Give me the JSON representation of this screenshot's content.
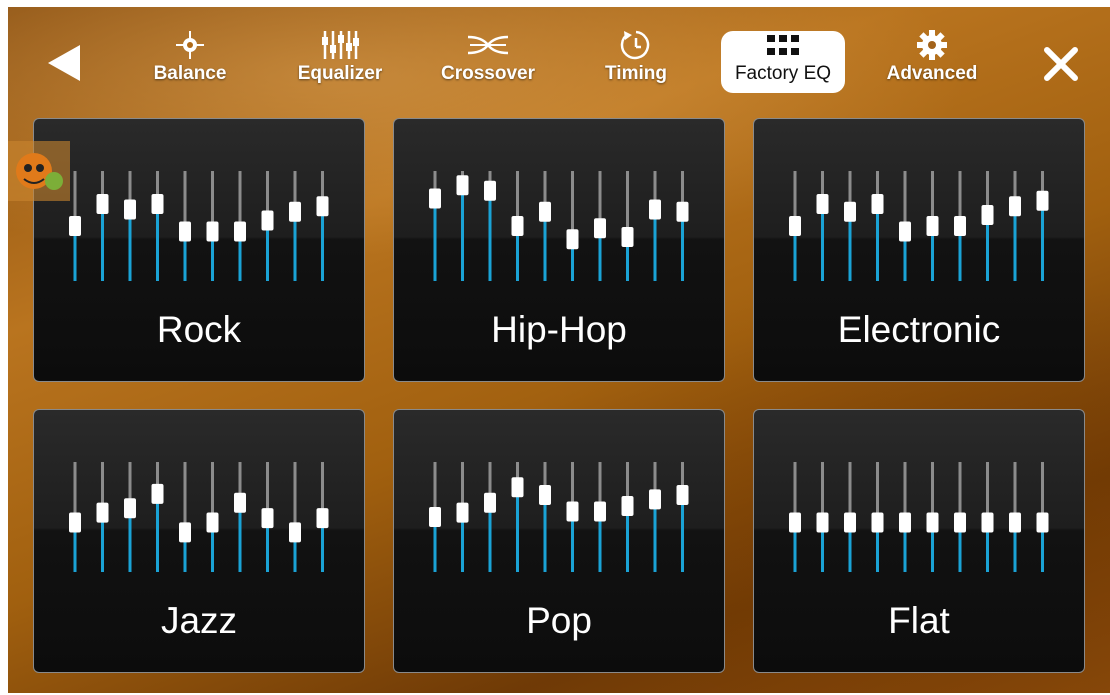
{
  "nav": {
    "items": [
      {
        "label": "Balance",
        "icon": "balance-icon"
      },
      {
        "label": "Equalizer",
        "icon": "equalizer-icon"
      },
      {
        "label": "Crossover",
        "icon": "crossover-icon"
      },
      {
        "label": "Timing",
        "icon": "timing-icon"
      },
      {
        "label": "Factory EQ",
        "icon": "grid-icon",
        "active": true
      },
      {
        "label": "Advanced",
        "icon": "gear-icon"
      }
    ]
  },
  "colors": {
    "slider_active": "#1aa3d6",
    "slider_track": "#8c8c8c",
    "knob": "#ffffff",
    "active_tab_bg": "#ffffff"
  },
  "presets": [
    {
      "name": "Rock",
      "levels": [
        0.5,
        0.7,
        0.65,
        0.7,
        0.45,
        0.45,
        0.45,
        0.55,
        0.63,
        0.68
      ]
    },
    {
      "name": "Hip-Hop",
      "levels": [
        0.75,
        0.87,
        0.82,
        0.5,
        0.63,
        0.38,
        0.48,
        0.4,
        0.65,
        0.63
      ]
    },
    {
      "name": "Electronic",
      "levels": [
        0.5,
        0.7,
        0.63,
        0.7,
        0.45,
        0.5,
        0.5,
        0.6,
        0.68,
        0.73
      ]
    },
    {
      "name": "Jazz",
      "levels": [
        0.45,
        0.54,
        0.58,
        0.71,
        0.36,
        0.45,
        0.63,
        0.49,
        0.36,
        0.49
      ]
    },
    {
      "name": "Pop",
      "levels": [
        0.5,
        0.54,
        0.63,
        0.77,
        0.7,
        0.55,
        0.55,
        0.6,
        0.66,
        0.7
      ]
    },
    {
      "name": "Flat",
      "levels": [
        0.45,
        0.45,
        0.45,
        0.45,
        0.45,
        0.45,
        0.45,
        0.45,
        0.45,
        0.45
      ]
    }
  ]
}
